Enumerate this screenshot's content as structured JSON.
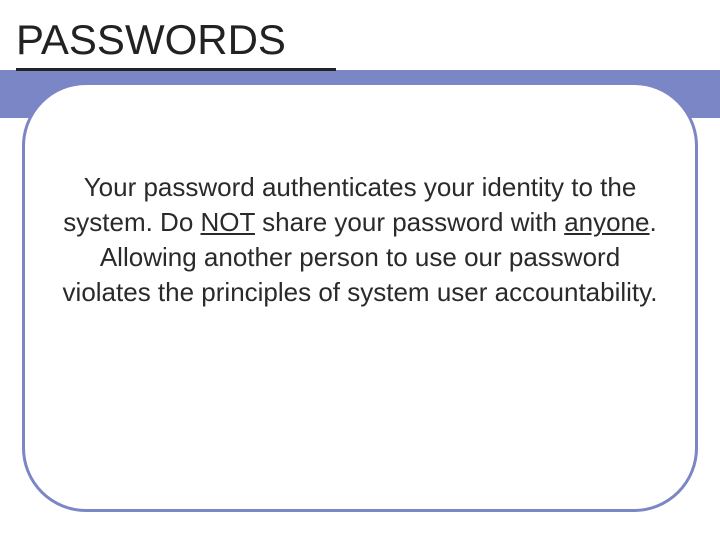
{
  "title": "PASSWORDS",
  "body": {
    "seg1": "Your password authenticates your identity to the system.  Do ",
    "not": "NOT",
    "seg2": " share your password with ",
    "anyone": "anyone",
    "seg3": ".  Allowing another person to use our password violates the principles of system user accountability."
  }
}
